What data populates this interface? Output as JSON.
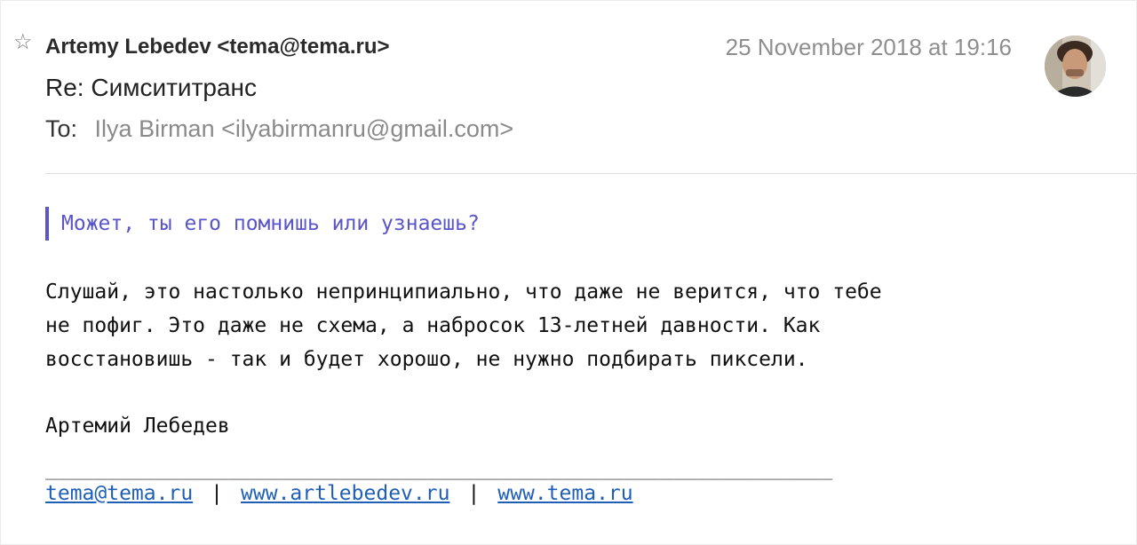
{
  "header": {
    "from": "Artemy Lebedev <tema@tema.ru>",
    "date": "25 November 2018 at 19:16",
    "subject": "Re: Симсититранс",
    "to_label": "To:",
    "to_value": "Ilya Birman <ilyabirmanru@gmail.com>"
  },
  "icons": {
    "star": "☆",
    "avatar": "sender-avatar-photo"
  },
  "body": {
    "quote": "Может, ты его помнишь или узнаешь?",
    "paragraph": [
      "Слушай, это настолько непринципиально, что даже не верится, что тебе",
      "не пофиг. Это даже не схема, а набросок 13-летней давности. Как",
      "восстановишь - так и будет хорошо, не нужно подбирать пиксели."
    ],
    "signature_name": "Артемий Лебедев",
    "signature_rule": "________________________________________________________________",
    "links": [
      "tema@tema.ru",
      "www.artlebedev.ru",
      "www.tema.ru"
    ],
    "link_separator": "|"
  },
  "colors": {
    "quote_accent": "#5a55c8",
    "link": "#1f5fb8",
    "date_gray": "#8e8e8e"
  }
}
